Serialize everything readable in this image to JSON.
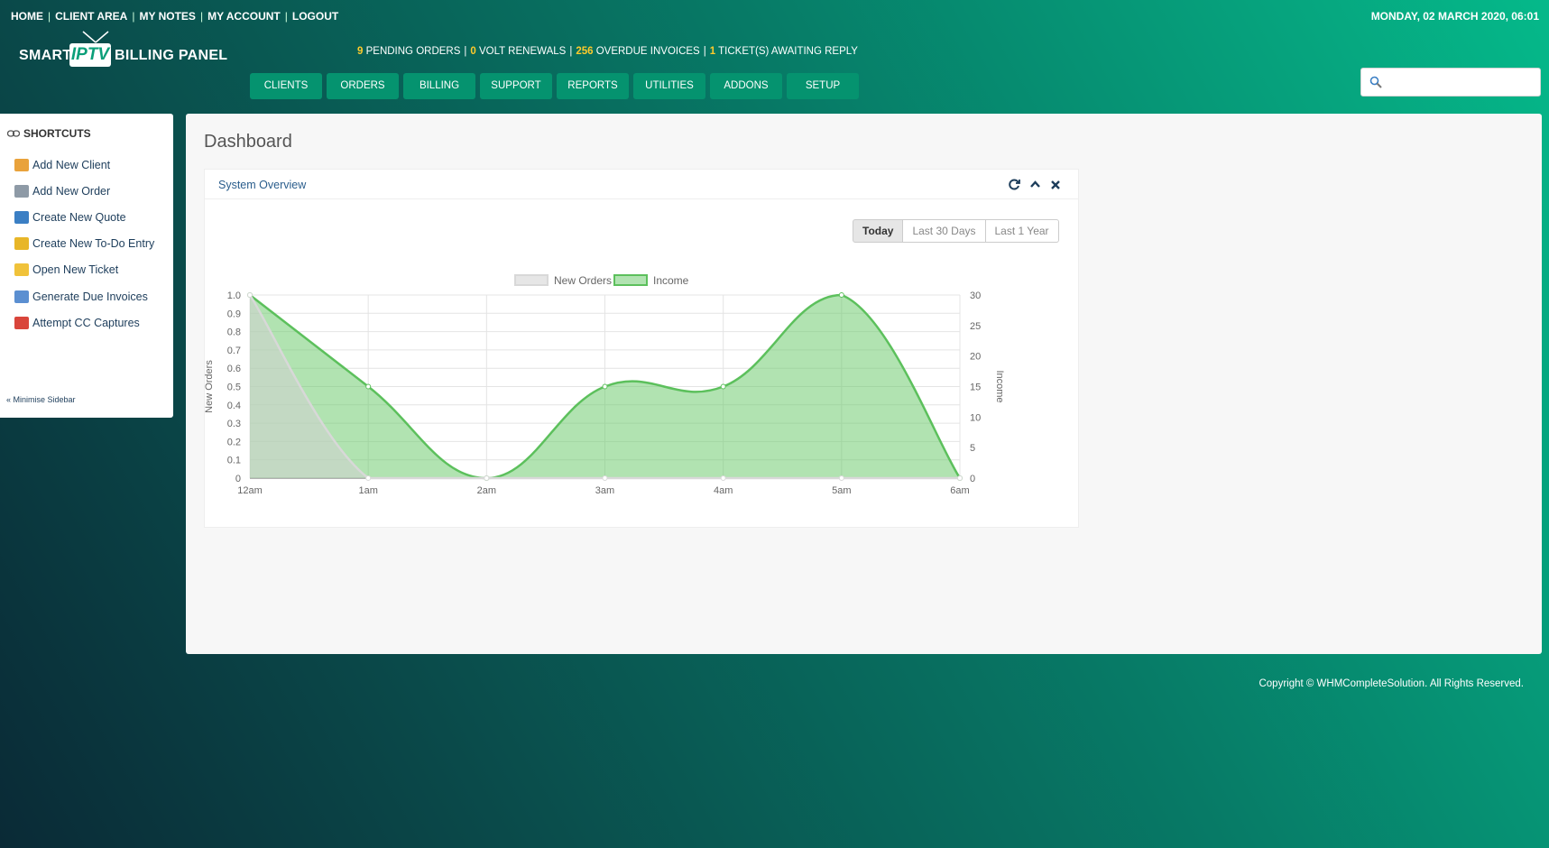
{
  "top_links": [
    "HOME",
    "CLIENT AREA",
    "MY NOTES",
    "MY ACCOUNT",
    "LOGOUT"
  ],
  "date": "MONDAY, 02 MARCH 2020, 06:01",
  "logo": {
    "smart": "SMART",
    "iptv": "IPTV",
    "billing": "BILLING PANEL"
  },
  "stats": {
    "pending_orders_count": "9",
    "pending_orders_label": "PENDING ORDERS",
    "volt_renewals_count": "0",
    "volt_renewals_label": "VOLT RENEWALS",
    "overdue_invoices_count": "256",
    "overdue_invoices_label": "OVERDUE INVOICES",
    "tickets_count": "1",
    "tickets_label": "TICKET(S) AWAITING REPLY"
  },
  "nav": [
    "CLIENTS",
    "ORDERS",
    "BILLING",
    "SUPPORT",
    "REPORTS",
    "UTILITIES",
    "ADDONS",
    "SETUP"
  ],
  "search": {
    "placeholder": "",
    "value": ""
  },
  "sidebar": {
    "heading": "SHORTCUTS",
    "items": [
      {
        "label": "Add New Client",
        "icon": "add-client-icon",
        "color": "#e9a23b"
      },
      {
        "label": "Add New Order",
        "icon": "cart-icon",
        "color": "#8e9aa6"
      },
      {
        "label": "Create New Quote",
        "icon": "quote-icon",
        "color": "#3b7fc4"
      },
      {
        "label": "Create New To-Do Entry",
        "icon": "todo-icon",
        "color": "#e8b628"
      },
      {
        "label": "Open New Ticket",
        "icon": "ticket-icon",
        "color": "#f0c23a"
      },
      {
        "label": "Generate Due Invoices",
        "icon": "invoice-icon",
        "color": "#5b8fd1"
      },
      {
        "label": "Attempt CC Captures",
        "icon": "cc-icon",
        "color": "#d9453b"
      }
    ],
    "minimise": "« Minimise Sidebar"
  },
  "main": {
    "title": "Dashboard",
    "widget_title": "System Overview",
    "range_buttons": [
      "Today",
      "Last 30 Days",
      "Last 1 Year"
    ],
    "active_range": "Today"
  },
  "chart_data": {
    "type": "area",
    "categories": [
      "12am",
      "1am",
      "2am",
      "3am",
      "4am",
      "5am",
      "6am"
    ],
    "series": [
      {
        "name": "New Orders",
        "axis": "left",
        "values": [
          1,
          0,
          0,
          0,
          0,
          0,
          0
        ],
        "color": "#d6d6d6"
      },
      {
        "name": "Income",
        "axis": "right",
        "values": [
          30,
          15,
          0,
          15,
          15,
          30,
          0
        ],
        "color": "#5cc05c"
      }
    ],
    "ylabel_left": "New Orders",
    "ylabel_right": "Income",
    "ylim_left": [
      0,
      1
    ],
    "ylim_right": [
      0,
      30
    ],
    "yticks_left": [
      "0",
      "0.1",
      "0.2",
      "0.3",
      "0.4",
      "0.5",
      "0.6",
      "0.7",
      "0.8",
      "0.9",
      "1.0"
    ],
    "yticks_right": [
      "0",
      "5",
      "10",
      "15",
      "20",
      "25",
      "30"
    ],
    "legend": "top-center",
    "grid": true
  },
  "footer": "Copyright © WHMCompleteSolution. All Rights Reserved.",
  "colors": {
    "accent": "#05936f",
    "stat_highlight": "#ffcb2b",
    "link": "#2a5d8c"
  }
}
